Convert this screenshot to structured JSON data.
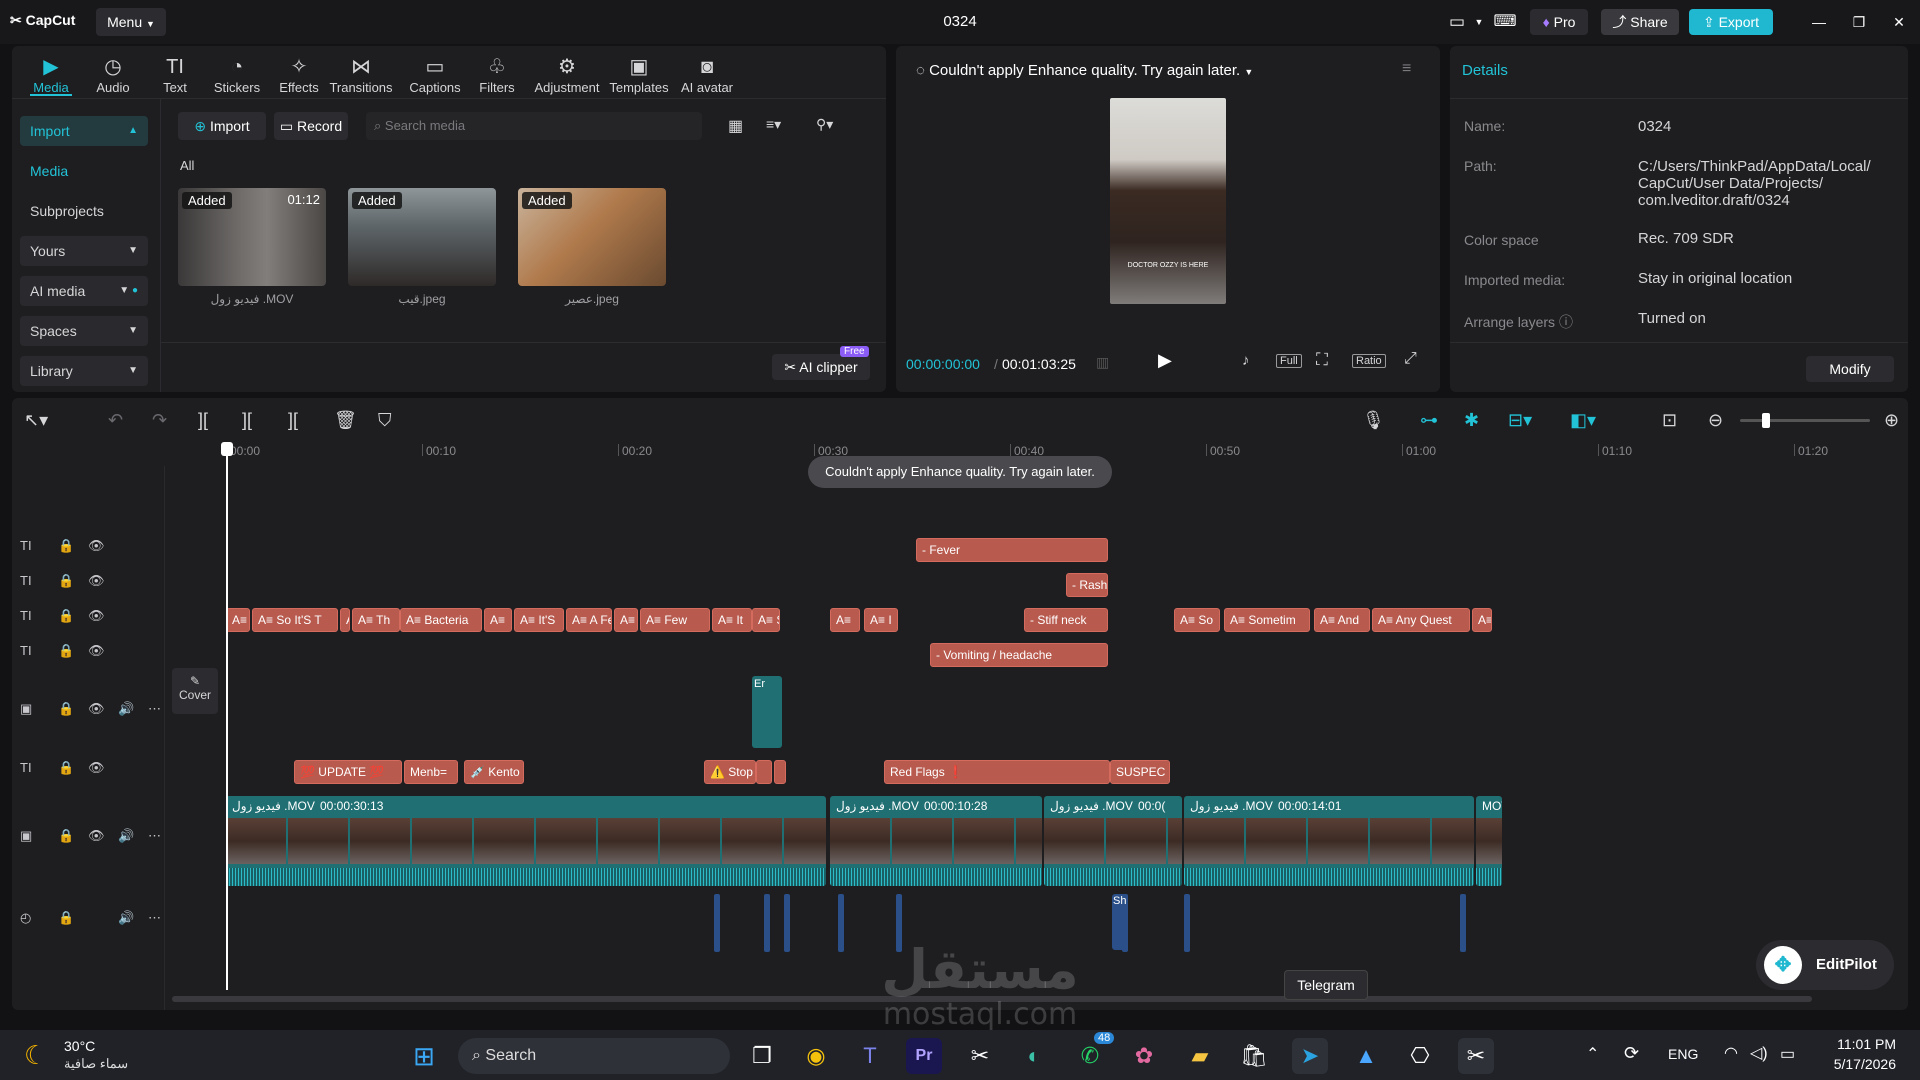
{
  "app": {
    "logo": "CapCut",
    "menu": "Menu",
    "project_title": "0324",
    "pro": "Pro",
    "share": "Share",
    "export": "Export"
  },
  "toolbar": [
    "Media",
    "Audio",
    "Text",
    "Stickers",
    "Effects",
    "Transitions",
    "Captions",
    "Filters",
    "Adjustment",
    "Templates",
    "AI avatar"
  ],
  "toolbar_icons": [
    "▶",
    "◷",
    "TI",
    "◔",
    "✧",
    "⋈",
    "▭",
    "♧",
    "⚙",
    "▣",
    "◙"
  ],
  "sidebar": {
    "import": "Import",
    "media": "Media",
    "subprojects": "Subprojects",
    "yours": "Yours",
    "ai_media": "AI media",
    "spaces": "Spaces",
    "library": "Library"
  },
  "media": {
    "import_btn": "Import",
    "record_btn": "Record",
    "search_placeholder": "Search media",
    "all": "All",
    "ai_clipper": "AI clipper",
    "free_badge": "Free",
    "items": [
      {
        "added": "Added",
        "duration": "01:12",
        "caption": "فيديو زول .MOV"
      },
      {
        "added": "Added",
        "duration": "",
        "caption": "قيب.jpeg"
      },
      {
        "added": "Added",
        "duration": "",
        "caption": "عصير.jpeg"
      }
    ]
  },
  "player": {
    "status": "Couldn't apply Enhance quality. Try again later.",
    "time_current": "00:00:00:00",
    "time_total": "00:01:03:25",
    "full": "Full",
    "ratio": "Ratio",
    "subtitle": "DOCTOR OZZY IS HERE"
  },
  "details": {
    "title": "Details",
    "modify": "Modify",
    "rows": [
      {
        "label": "Name:",
        "value": "0324"
      },
      {
        "label": "Path:",
        "value": "C:/Users/ThinkPad/AppData/Local/\nCapCut/User Data/Projects/\ncom.lveditor.draft/0324"
      },
      {
        "label": "Color space",
        "value": "Rec. 709 SDR"
      },
      {
        "label": "Imported media:",
        "value": "Stay in original location"
      },
      {
        "label": "Arrange layers",
        "value": "Turned on"
      }
    ]
  },
  "timeline": {
    "ruler": [
      "00:00",
      "00:10",
      "00:20",
      "00:30",
      "00:40",
      "00:50",
      "01:00",
      "01:10",
      "01:20"
    ],
    "toast": "Couldn't apply Enhance quality. Try again later.",
    "cover": "Cover",
    "text_clips_row1": [
      "- Fever"
    ],
    "text_clips_row2": [
      "- Rash"
    ],
    "text_clips_row3": [
      "A≡",
      "A≡ So It'S T",
      "A",
      "A≡ Th",
      "A≡ Bacteria",
      "A≡",
      "A≡ It'S",
      "A≡ A Fe",
      "A≡",
      "A≡ Few",
      "A≡ It",
      "A≡ S",
      "A≡",
      "A≡ I",
      "- Stiff neck",
      "A≡ So",
      "A≡ Sometim",
      "A≡ And",
      "A≡ Any Quest",
      "A≡"
    ],
    "text_clips_row4": [
      "- Vomiting / headache"
    ],
    "overlay_clip": "Er",
    "sticker_clips": [
      "💯 UPDATE 💯",
      "Menb=",
      "💉 Kento",
      "⚠️ Stop",
      "",
      "",
      "Red Flags ❗",
      "SUSPEC"
    ],
    "video_clips": [
      {
        "name": "فيديو زول .MOV",
        "time": "00:00:30:13"
      },
      {
        "name": "فيديو زول .MOV",
        "time": "00:00:10:28"
      },
      {
        "name": "فيديو زول .MOV",
        "time": "00:0("
      },
      {
        "name": "فيديو زول .MOV",
        "time": "00:00:14:01"
      },
      {
        "name": "MOV",
        "time": ""
      }
    ],
    "audio_clip": "Sh"
  },
  "editpilot": "EditPilot",
  "telegram_tooltip": "Telegram",
  "watermark": {
    "ar": "مستقل",
    "en": "mostaql.com"
  },
  "taskbar": {
    "temp": "30°C",
    "weather": "سماء صافية",
    "search": "Search",
    "lang": "ENG",
    "time": "11:01 PM",
    "date": "5/17/2026",
    "badge": "48"
  },
  "colors": {
    "accent": "#22c3d6",
    "export_bg": "#1fb8d0",
    "text_clip": "#b85a4e",
    "video_clip": "#1f6f73"
  }
}
